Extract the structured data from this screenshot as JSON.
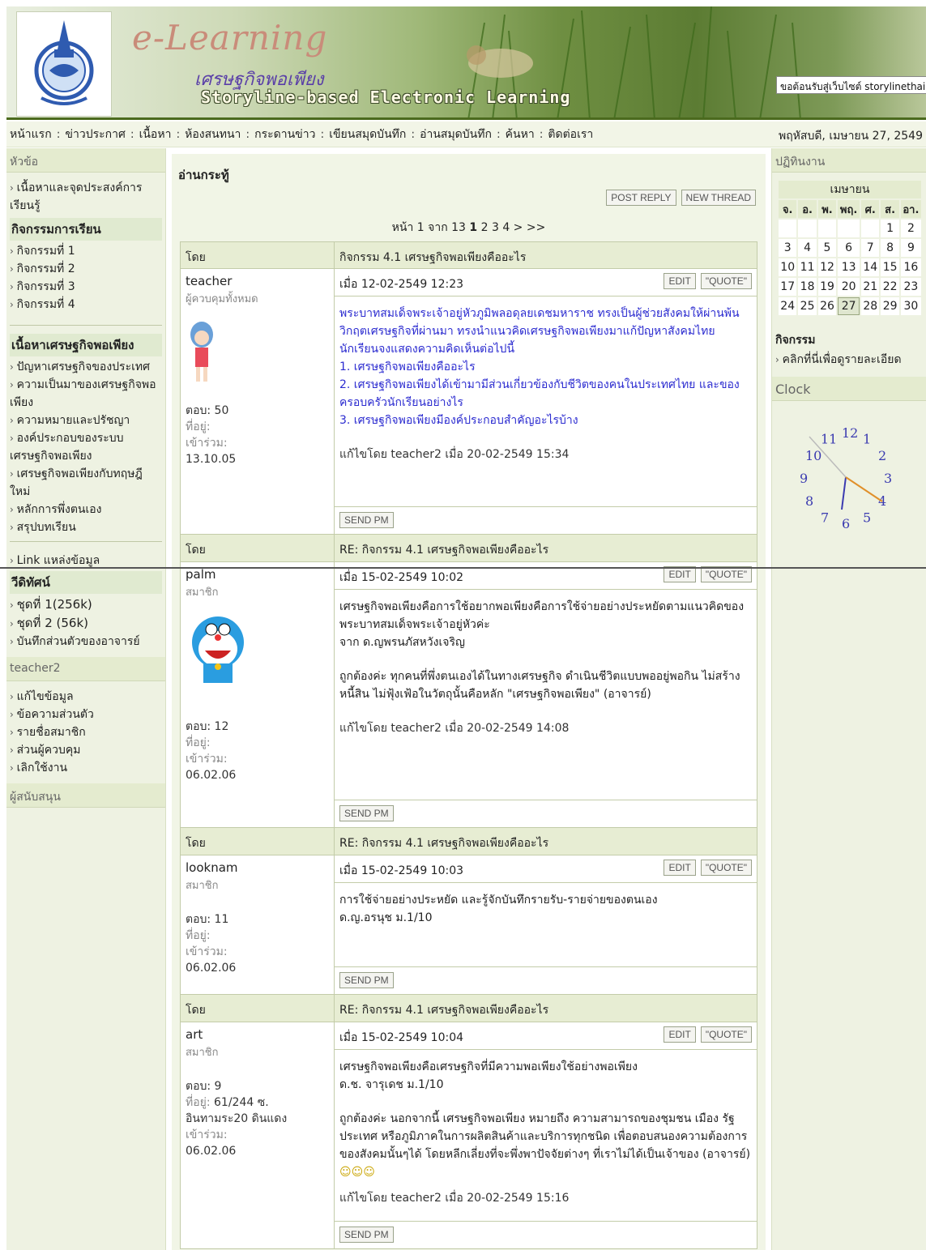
{
  "banner": {
    "title": "e-Learning",
    "subtitle": "เศรษฐกิจพอเพียง",
    "tagline": "Storyline-based  Electronic Learning",
    "welcome": "ขอต้อนรับสู่เว็บไซต์ storylinethai.c"
  },
  "nav": {
    "items": [
      "หน้าแรก",
      "ข่าวประกาศ",
      "เนื้อหา",
      "ห้องสนทนา",
      "กระดานข่าว",
      "เขียนสมุดบันทึก",
      "อ่านสมุดบันทึก",
      "ค้นหา",
      "ติดต่อเรา"
    ],
    "date": "พฤหัสบดี, เมษายน 27, 2549"
  },
  "left": {
    "topic_title": "หัวข้อ",
    "intro_item": "เนื้อหาและจุดประสงค์การเรียนรู้",
    "activities_head": "กิจกรรมการเรียน",
    "activities": [
      "กิจกรรมที่ 1",
      "กิจกรรมที่ 2",
      "กิจกรรมที่ 3",
      "กิจกรรมที่ 4"
    ],
    "content_head": "เนื้อหาเศรษฐกิจพอเพียง",
    "content_items": [
      "ปัญหาเศรษฐกิจของประเทศ",
      "ความเป็นมาของเศรษฐกิจพอเพียง",
      "ความหมายและปรัชญา",
      "องค์ประกอบของระบบเศรษฐกิจพอเพียง",
      "เศรษฐกิจพอเพียงกับทฤษฎีใหม่",
      "หลักการพึ่งตนเอง",
      "สรุปบทเรียน"
    ],
    "link_item": "Link แหล่งข้อมูล",
    "video_head": "วีดิทัศน์",
    "video_items": [
      "ชุดที่ 1(256k)",
      "ชุดที่ 2 (56k)",
      "บันทึกส่วนตัวของอาจารย์"
    ],
    "user_title": "teacher2",
    "user_items": [
      "แก้ไขข้อมูล",
      "ข้อความส่วนตัว",
      "รายชื่อสมาชิก",
      "ส่วนผู้ควบคุม",
      "เลิกใช้งาน"
    ],
    "sponsor_title": "ผู้สนับสนุน"
  },
  "right": {
    "calendar_title": "ปฏิทินงาน",
    "month": "เมษายน",
    "dow": [
      "จ.",
      "อ.",
      "พ.",
      "พฤ.",
      "ศ.",
      "ส.",
      "อา."
    ],
    "weeks": [
      [
        "",
        "",
        "",
        "",
        "",
        "1",
        "2"
      ],
      [
        "3",
        "4",
        "5",
        "6",
        "7",
        "8",
        "9"
      ],
      [
        "10",
        "11",
        "12",
        "13",
        "14",
        "15",
        "16"
      ],
      [
        "17",
        "18",
        "19",
        "20",
        "21",
        "22",
        "23"
      ],
      [
        "24",
        "25",
        "26",
        "27",
        "28",
        "29",
        "30"
      ]
    ],
    "today": "27",
    "activity_head": "กิจกรรม",
    "activity_link": "คลิกที่นี่เพื่อดูรายละเอียด",
    "clock_title": "Clock",
    "clock_numbers": [
      "12",
      "1",
      "2",
      "3",
      "4",
      "5",
      "6",
      "7",
      "8",
      "9",
      "10",
      "11"
    ]
  },
  "main": {
    "title": "อ่านกระทู้",
    "post_reply": "POST REPLY",
    "new_thread": "NEW THREAD",
    "pagination": {
      "prefix": "หน้า 1 จาก 13",
      "current": "1",
      "pages": "2 3 4 > >>"
    },
    "by_label": "โดย",
    "edit_label": "EDIT",
    "quote_label": "\"QUOTE\"",
    "send_pm_label": "SEND PM",
    "posts": [
      {
        "subject": "กิจกรรม 4.1 เศรษฐกิจพอเพียงคืออะไร",
        "user": "teacher",
        "role": "ผู้ควบคุมทั้งหมด",
        "posts_label": "ตอบ: 50",
        "loc_label": "ที่อยู่:",
        "loc": "",
        "join_label": "เข้าร่วม:",
        "join": "13.10.05",
        "date": "เมื่อ 12-02-2549 12:23",
        "body": [
          "พระบาทสมเด็จพระเจ้าอยู่หัวภูมิพลอดุลยเดชมหาราช ทรงเป็นผู้ช่วยสังคมให้ผ่านพ้นวิกฤตเศรษฐกิจที่ผ่านมา ทรงนำแนวคิดเศรษฐกิจพอเพียงมาแก้ปัญหาสังคมไทย นักเรียนจงแสดงความคิดเห็นต่อไปนี้",
          "1. เศรษฐกิจพอเพียงคืออะไร",
          "2. เศรษฐกิจพอเพียงได้เข้ามามีส่วนเกี่ยวข้องกับชีวิตของคนในประเทศไทย และของครอบครัวนักเรียนอย่างไร",
          "3. เศรษฐกิจพอเพียงมีองค์ประกอบสำคัญอะไรบ้าง"
        ],
        "edit_note": "แก้ไขโดย teacher2 เมื่อ 20-02-2549 15:34"
      },
      {
        "subject": "RE: กิจกรรม 4.1 เศรษฐกิจพอเพียงคืออะไร",
        "user": "palm",
        "role": "สมาชิก",
        "posts_label": "ตอบ: 12",
        "loc_label": "ที่อยู่:",
        "loc": "",
        "join_label": "เข้าร่วม:",
        "join": "06.02.06",
        "date": "เมื่อ 15-02-2549 10:02",
        "body": [
          "เศรษฐกิจพอเพียงคือการใช้อยากพอเพียงคือการใช้จ่ายอย่างประหยัดตามแนวคิดของพระบาทสมเด็จพระเจ้าอยู่หัวค่ะ",
          "จาก ด.ญพรนภัสหวังเจริญ"
        ],
        "reply": "ถูกต้องค่ะ ทุกคนที่พึ่งตนเองได้ในทางเศรษฐกิจ ดำเนินชีวิตแบบพออยู่พอกิน ไม่สร้างหนี้สิน ไม่ฟุ้งเฟ้อในวัตถุนั้นคือหลัก \"เศรษฐกิจพอเพียง\" (อาจารย์)",
        "edit_note": "แก้ไขโดย teacher2 เมื่อ 20-02-2549 14:08"
      },
      {
        "subject": "RE: กิจกรรม 4.1 เศรษฐกิจพอเพียงคืออะไร",
        "user": "looknam",
        "role": "สมาชิก",
        "posts_label": "ตอบ: 11",
        "loc_label": "ที่อยู่:",
        "loc": "",
        "join_label": "เข้าร่วม:",
        "join": "06.02.06",
        "date": "เมื่อ 15-02-2549 10:03",
        "body": [
          "การใช้จ่ายอย่างประหยัด และรู้จักบันทึกรายรับ-รายจ่ายของตนเอง",
          "ด.ญ.อรนุช ม.1/10"
        ]
      },
      {
        "subject": "RE: กิจกรรม 4.1 เศรษฐกิจพอเพียงคืออะไร",
        "user": "art",
        "role": "สมาชิก",
        "posts_label": "ตอบ: 9",
        "loc_label": "ที่อยู่:",
        "loc": "61/244 ซ. อินทามระ20 ดินแดง",
        "join_label": "เข้าร่วม:",
        "join": "06.02.06",
        "date": "เมื่อ 15-02-2549 10:04",
        "body": [
          "เศรษฐกิจพอเพียงคือเศรษฐกิจที่มีความพอเพียงใช้อย่างพอเพียง",
          "ด.ช. จารุเดช ม.1/10"
        ],
        "reply": "ถูกต้องค่ะ นอกจากนี้ เศรษฐกิจพอเพียง หมายถึง ความสามารถของชุมชน เมือง รัฐ ประเทศ หรือภูมิภาคในการผลิตสินค้าและบริการทุกชนิด เพื่อตอบสนองความต้องการของสังคมนั้นๆได้ โดยหลีกเลี่ยงที่จะพึ่งพาปัจจัยต่างๆ ที่เราไม่ได้เป็นเจ้าของ (อาจารย์)",
        "edit_note": "แก้ไขโดย teacher2 เมื่อ 20-02-2549 15:16"
      }
    ]
  },
  "colors": {
    "accent": "#e4ebcf",
    "link_blue": "#2c2cd0",
    "banner_green": "#5c7c33"
  }
}
